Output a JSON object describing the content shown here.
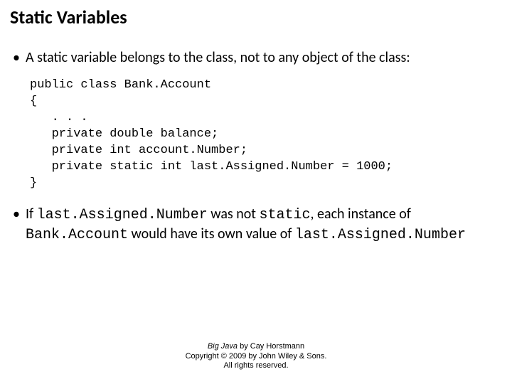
{
  "title": "Static Variables",
  "bullet1": "A static variable belongs to the class, not to any object of the class:",
  "code": {
    "l1": "public class Bank.Account",
    "l2": "{",
    "l3": "   . . .",
    "l4": "   private double balance;",
    "l5": "   private int account.Number;",
    "l6": "   private static int last.Assigned.Number = 1000;",
    "l7": "}"
  },
  "bullet2": {
    "p1": "If ",
    "c1": "last.Assigned.Number",
    "p2": " was not ",
    "c2": "static",
    "p3": ", each instance of ",
    "c3": "Bank.Account",
    "p4": " would have its own value of ",
    "c4": "last.Assigned.Number"
  },
  "footer": {
    "book": "Big Java",
    "author": " by Cay Horstmann",
    "copyright": "Copyright © 2009 by John Wiley & Sons.",
    "rights": "All rights reserved."
  }
}
